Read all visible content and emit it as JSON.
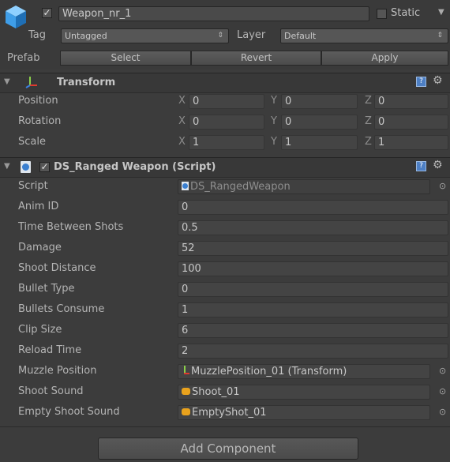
{
  "object": {
    "name": "Weapon_nr_1",
    "static_label": "Static",
    "tag_label": "Tag",
    "tag_value": "Untagged",
    "layer_label": "Layer",
    "layer_value": "Default",
    "prefab_label": "Prefab",
    "prefab_select": "Select",
    "prefab_revert": "Revert",
    "prefab_apply": "Apply"
  },
  "transform": {
    "title": "Transform",
    "rows": [
      {
        "label": "Position",
        "x": "0",
        "y": "0",
        "z": "0"
      },
      {
        "label": "Rotation",
        "x": "0",
        "y": "0",
        "z": "0"
      },
      {
        "label": "Scale",
        "x": "1",
        "y": "1",
        "z": "1"
      }
    ],
    "axis_x": "X",
    "axis_y": "Y",
    "axis_z": "Z"
  },
  "script_component": {
    "title": "DS_Ranged Weapon (Script)",
    "fields": [
      {
        "label": "Script",
        "value": "DS_RangedWeapon"
      },
      {
        "label": "Anim ID",
        "value": "0"
      },
      {
        "label": "Time Between Shots",
        "value": "0.5"
      },
      {
        "label": "Damage",
        "value": "52"
      },
      {
        "label": "Shoot Distance",
        "value": "100"
      },
      {
        "label": "Bullet Type",
        "value": "0"
      },
      {
        "label": "Bullets Consume",
        "value": "1"
      },
      {
        "label": "Clip Size",
        "value": "6"
      },
      {
        "label": "Reload Time",
        "value": "2"
      },
      {
        "label": "Muzzle Position",
        "value": "MuzzlePosition_01 (Transform)"
      },
      {
        "label": "Shoot Sound",
        "value": "Shoot_01"
      },
      {
        "label": "Empty Shoot Sound",
        "value": "EmptyShot_01"
      }
    ]
  },
  "add_component_label": "Add Component",
  "colors": {
    "background": "#3c3c3c",
    "field": "#4a4a4a",
    "header": "#383838",
    "text": "#b4b4b4"
  }
}
